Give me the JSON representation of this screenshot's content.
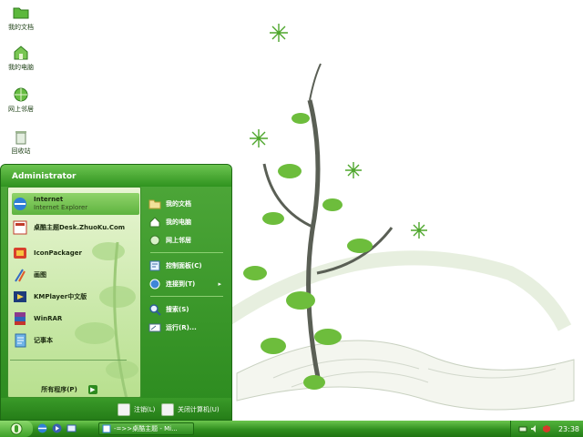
{
  "desktop": {
    "icons": [
      {
        "label": "我的文档",
        "icon": "folder-icon"
      },
      {
        "label": "我的电脑",
        "icon": "computer-icon"
      },
      {
        "label": "网上邻居",
        "icon": "network-icon"
      },
      {
        "label": "回收站",
        "icon": "recycle-bin-icon"
      }
    ]
  },
  "start_menu": {
    "user": "Administrator",
    "pinned": [
      {
        "title": "Internet",
        "subtitle": "Internet Explorer",
        "icon": "internet-explorer-icon"
      },
      {
        "title": "桌酷主题Desk.ZhuoKu.Com",
        "icon": "zhuoku-icon"
      }
    ],
    "recent": [
      {
        "title": "IconPackager",
        "icon": "iconpackager-icon"
      },
      {
        "title": "画图",
        "icon": "paint-icon"
      },
      {
        "title": "KMPlayer中文版",
        "icon": "kmplayer-icon"
      },
      {
        "title": "WinRAR",
        "icon": "winrar-icon"
      },
      {
        "title": "记事本",
        "icon": "notepad-icon"
      }
    ],
    "all_programs": "所有程序(P)",
    "right": [
      {
        "label": "我的文档",
        "icon": "folder-icon"
      },
      {
        "label": "我的电脑",
        "icon": "computer-icon"
      },
      {
        "label": "网上邻居",
        "icon": "network-icon"
      },
      {
        "label": "控制面板(C)",
        "icon": "control-panel-icon"
      },
      {
        "label": "连接到(T)",
        "icon": "connect-icon",
        "caret": "▸"
      },
      {
        "label": "搜索(S)",
        "icon": "search-icon"
      },
      {
        "label": "运行(R)...",
        "icon": "run-icon"
      }
    ],
    "logoff": "注销(L)",
    "shutdown": "关闭计算机(U)"
  },
  "taskbar": {
    "task_label": "-=>>桌酷主题 - Mi...",
    "clock": "23:38"
  },
  "colors": {
    "accent": "#2f8e1e",
    "header": "#4fa83a",
    "leaf": "#5cb83c"
  }
}
